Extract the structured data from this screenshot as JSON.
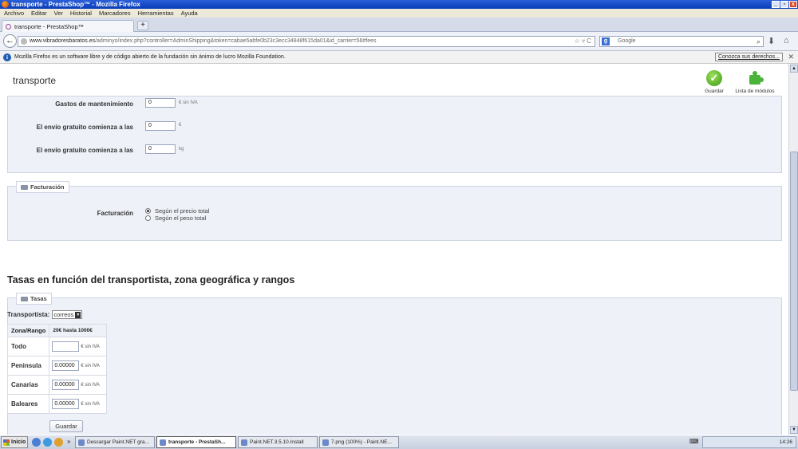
{
  "window": {
    "title": "transporte - PrestaShop™ - Mozilla Firefox"
  },
  "menu": [
    "Archivo",
    "Editar",
    "Ver",
    "Historial",
    "Marcadores",
    "Herramientas",
    "Ayuda"
  ],
  "tab": {
    "label": "transporte - PrestaShop™",
    "new_tab": "+"
  },
  "nav": {
    "url_host": "www.vibradoresbaratos.es",
    "url_path": "/adminyo/index.php?controller=AdminShipping&token=cabae5abfe0b23c3ecc34848f615da01&id_carrier=56#fees",
    "search_placeholder": "Google",
    "search_engine": "g"
  },
  "notification": {
    "text": "Mozilla Firefox es un software libre y de código abierto de la fundación sin ánimo de lucro Mozilla Foundation.",
    "learn_more": "Conozca sus derechos..."
  },
  "admin": {
    "title": "transporte",
    "save_label": "Guardar",
    "modules_label": "Lista de módulos"
  },
  "fees": {
    "rows": [
      {
        "label": "Gastos de mantenimiento",
        "value": "0",
        "unit": "€ sin IVA"
      },
      {
        "label": "El envío gratuito comienza a las",
        "value": "0",
        "unit": "€"
      },
      {
        "label": "El envío gratuito comienza a las",
        "value": "0",
        "unit": "kg"
      }
    ]
  },
  "billing": {
    "legend": "Facturación",
    "label": "Facturación",
    "options": [
      {
        "label": "Según el precio total",
        "selected": true
      },
      {
        "label": "Según el peso total",
        "selected": false
      }
    ]
  },
  "rates": {
    "heading": "Tasas en función del transportista, zona geográfica y rangos",
    "legend": "Tasas",
    "carrier_label": "Transportista:",
    "carrier_value": "correos",
    "col_zone": "Zona/Rango",
    "col_range": "20€ hasta 1000€",
    "unit": "€ sin IVA",
    "zones": [
      {
        "name": "Todo",
        "value": ""
      },
      {
        "name": "Peninsula",
        "value": "0.00000"
      },
      {
        "name": "Canarias",
        "value": "0.00000"
      },
      {
        "name": "Baleares",
        "value": "0.00000"
      }
    ],
    "save_button": "Guardar"
  },
  "taskbar": {
    "start": "Inicio",
    "tasks": [
      "Descargar Paint.NET gra...",
      "transporte - PrestaSh...",
      "Paint.NET.3.5.10.Install",
      "7.png (100%) - Paint.NE..."
    ],
    "clock": "14:26"
  }
}
